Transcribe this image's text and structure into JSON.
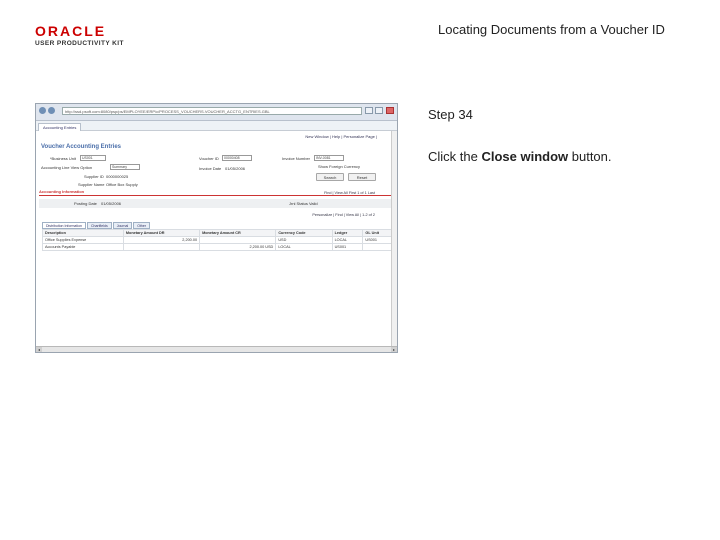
{
  "header": {
    "logo_brand": "ORACLE",
    "logo_subtitle": "USER PRODUCTIVITY KIT",
    "title": "Locating Documents from a Voucher ID"
  },
  "step": {
    "title": "Step 34",
    "instruction_prefix": "Click the ",
    "instruction_target": "Close window",
    "instruction_suffix": " button."
  },
  "screenshot": {
    "url": "http://ssd.psoft.com:8080/psp/ps/EMPLOYEE/ERP/c/PROCESS_VOUCHERS.VOUCHER_ACCTG_ENTRIES.GBL",
    "tab_label": "Accounting Entries",
    "toplinks": "New Window | Help | Personalize Page |",
    "page_heading": "Voucher Accounting Entries",
    "fields": {
      "bu_label": "*Business Unit",
      "bu_value": "US001",
      "voucher_label": "Voucher ID",
      "voucher_value": "00000408",
      "invoice_label": "Invoice Number",
      "invoice_value": "INV-0081",
      "acct_option_label": "Accounting Line View Option",
      "acct_option_value": "Summary",
      "invoice_date_label": "Invoice Date",
      "invoice_date_value": "01/05/2006",
      "supplier_label": "Supplier ID",
      "supplier_value": "0000000025",
      "supplier_name_label": "Supplier Name",
      "supplier_name_value": "Office Box Supply",
      "foreign_label": "Show Foreign Currency",
      "search_btn": "Search",
      "reset_btn": "Reset"
    },
    "section_title": "Accounting Information",
    "section_nav": "Find | View All    First  1 of 1  Last",
    "posting_label": "Posting Date",
    "posting_value": "01/05/2006",
    "journal_status": "Jrnl Status  Valid",
    "grid_nav": "Personalize | Find | View All | 1-2 of 2",
    "tabs": [
      "Distribution Information",
      "Chartfields",
      "Journal",
      "Other"
    ],
    "table": {
      "headers": [
        "Description",
        "Monetary Amount DR",
        "Monetary Amount CR",
        "Currency Code",
        "Ledger",
        "GL Unit"
      ],
      "rows": [
        [
          "Office Supplies Expense",
          "2,200.00",
          "",
          "USD",
          "LOCAL",
          "US001"
        ],
        [
          "Accounts Payable",
          "",
          "2,200.00 USD",
          "LOCAL",
          "US001",
          ""
        ]
      ]
    }
  }
}
